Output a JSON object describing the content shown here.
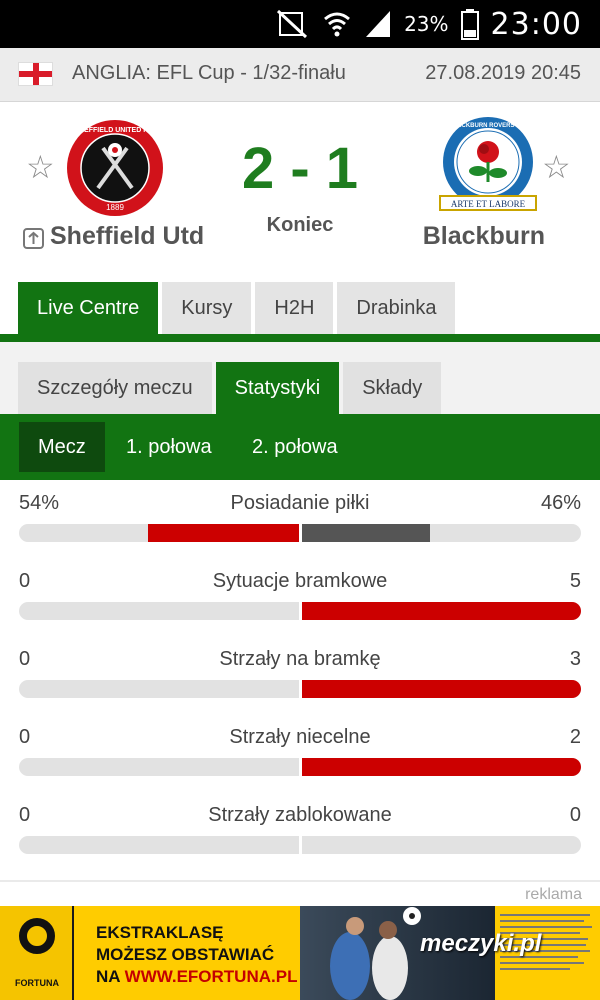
{
  "status_bar": {
    "battery": "23%",
    "time": "23:00"
  },
  "header": {
    "competition": "ANGLIA: EFL Cup - 1/32-finału",
    "datetime": "27.08.2019 20:45"
  },
  "match": {
    "home": {
      "name": "Sheffield Utd",
      "crest_text": "SHEFFIELD UNITED F.C.",
      "founded": "1889"
    },
    "away": {
      "name": "Blackburn",
      "crest_text": "BLACKBURN ROVERS F.C.",
      "motto": "ARTE ET LABORE"
    },
    "score": "2 - 1",
    "status": "Koniec"
  },
  "tabs": [
    "Live Centre",
    "Kursy",
    "H2H",
    "Drabinka"
  ],
  "sub_tabs": [
    "Szczegóły meczu",
    "Statystyki",
    "Składy"
  ],
  "periods": [
    "Mecz",
    "1. połowa",
    "2. połowa"
  ],
  "stats": [
    {
      "label": "Posiadanie piłki",
      "home": "54%",
      "away": "46%",
      "home_share": 0.54,
      "away_share": 0.46
    },
    {
      "label": "Sytuacje bramkowe",
      "home": "0",
      "away": "5",
      "home_share": 0,
      "away_share": 1
    },
    {
      "label": "Strzały na bramkę",
      "home": "0",
      "away": "3",
      "home_share": 0,
      "away_share": 1
    },
    {
      "label": "Strzały niecelne",
      "home": "0",
      "away": "2",
      "home_share": 0,
      "away_share": 1
    },
    {
      "label": "Strzały zablokowane",
      "home": "0",
      "away": "0",
      "home_share": 0,
      "away_share": 0
    }
  ],
  "colors": {
    "accent": "#127412",
    "home_bar": "#cc0000",
    "away_bar_possession": "#555555",
    "away_bar": "#cc0000"
  },
  "ad": {
    "label": "reklama",
    "brand": "FORTUNA",
    "line1": "EKSTRAKLASĘ",
    "line2": "MOŻESZ OBSTAWIAĆ",
    "line3_prefix": "NA ",
    "line3_link": "WWW.EFORTUNA.PL",
    "watermark": "meczyki.pl"
  }
}
